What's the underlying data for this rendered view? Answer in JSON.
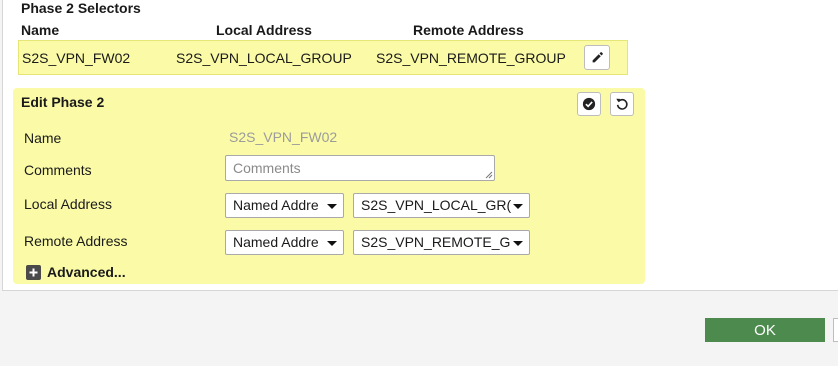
{
  "selectors": {
    "title": "Phase 2 Selectors",
    "columns": {
      "name": "Name",
      "local": "Local Address",
      "remote": "Remote Address"
    },
    "row": {
      "name": "S2S_VPN_FW02",
      "local": "S2S_VPN_LOCAL_GROUP",
      "remote": "S2S_VPN_REMOTE_GROUP"
    }
  },
  "edit": {
    "title": "Edit Phase 2",
    "name_label": "Name",
    "name_value": "S2S_VPN_FW02",
    "comments_label": "Comments",
    "comments_placeholder": "Comments",
    "local_label": "Local Address",
    "local_type": "Named Addre",
    "local_value": "S2S_VPN_LOCAL_GR(",
    "remote_label": "Remote Address",
    "remote_type": "Named Addre",
    "remote_value": "S2S_VPN_REMOTE_G",
    "advanced_label": "Advanced..."
  },
  "footer": {
    "ok_label": "OK"
  },
  "colors": {
    "highlight": "#fbfba7",
    "ok_button": "#4d8a4d"
  },
  "icons": {
    "edit": "pencil-icon",
    "apply": "check-circle-icon",
    "revert": "undo-icon",
    "expand": "plus-square-icon"
  }
}
